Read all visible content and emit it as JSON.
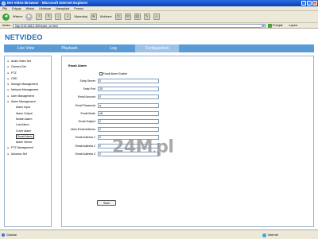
{
  "window": {
    "title": "Net Video Browser - Microsoft Internet Explorer"
  },
  "menu": [
    "Plik",
    "Edycja",
    "Widok",
    "Ulubione",
    "Narzędzia",
    "Pomoc"
  ],
  "toolbar": {
    "back": "Wstecz",
    "search": "Wyszukaj",
    "favorites": "Ulubione"
  },
  "address": {
    "label": "Adres",
    "url": "http://192.168.0.250/index_ch.html",
    "go": "Przejdź",
    "links": "Łącza"
  },
  "app": {
    "brand": "NETVIDEO",
    "tabs": [
      "Live View",
      "Playback",
      "Log",
      "Configuration"
    ],
    "active_tab": "Configuration"
  },
  "sidebar": [
    {
      "label": "Audio Video Set",
      "sub": false
    },
    {
      "label": "Camera Set",
      "sub": false
    },
    {
      "label": "PTZ",
      "sub": false
    },
    {
      "label": "OSD",
      "sub": false
    },
    {
      "label": "Storage Management",
      "sub": false
    },
    {
      "label": "Network Management",
      "sub": false
    },
    {
      "label": "User Management",
      "sub": false
    },
    {
      "label": "Alarm Management",
      "sub": false
    },
    {
      "label": "Alarm Input",
      "sub": true
    },
    {
      "label": "Alarm Output",
      "sub": true
    },
    {
      "label": "Motion Alarm",
      "sub": true
    },
    {
      "label": "Lost Alarm",
      "sub": true
    },
    {
      "label": "Cover Alarm",
      "sub": true
    },
    {
      "label": "Email Alarm",
      "sub": true,
      "selected": true
    },
    {
      "label": "Alarm Server",
      "sub": true
    },
    {
      "label": "PTZ Management",
      "sub": false
    },
    {
      "label": "Advance Set",
      "sub": false
    }
  ],
  "form": {
    "title": "Email Alarm",
    "enable_label": "Email Alarm Enable",
    "fields": [
      {
        "label": "Smtp Server",
        "value": "0"
      },
      {
        "label": "Smtp Port",
        "value": "25"
      },
      {
        "label": "Email Account",
        "value": "0"
      },
      {
        "label": "Email Password",
        "value": "●"
      },
      {
        "label": "Email Mode",
        "value": "off"
      },
      {
        "label": "Email Subject",
        "value": "0"
      },
      {
        "label": "Main Email Address",
        "value": "0"
      },
      {
        "label": "Email Address 1",
        "value": "0"
      },
      {
        "label": "Email Address 2",
        "value": "0"
      },
      {
        "label": "Email Address 3",
        "value": "0"
      }
    ],
    "save_label": "Save"
  },
  "watermark": "24M.pl",
  "status": {
    "left": "Gotowe",
    "right": "Internet"
  }
}
